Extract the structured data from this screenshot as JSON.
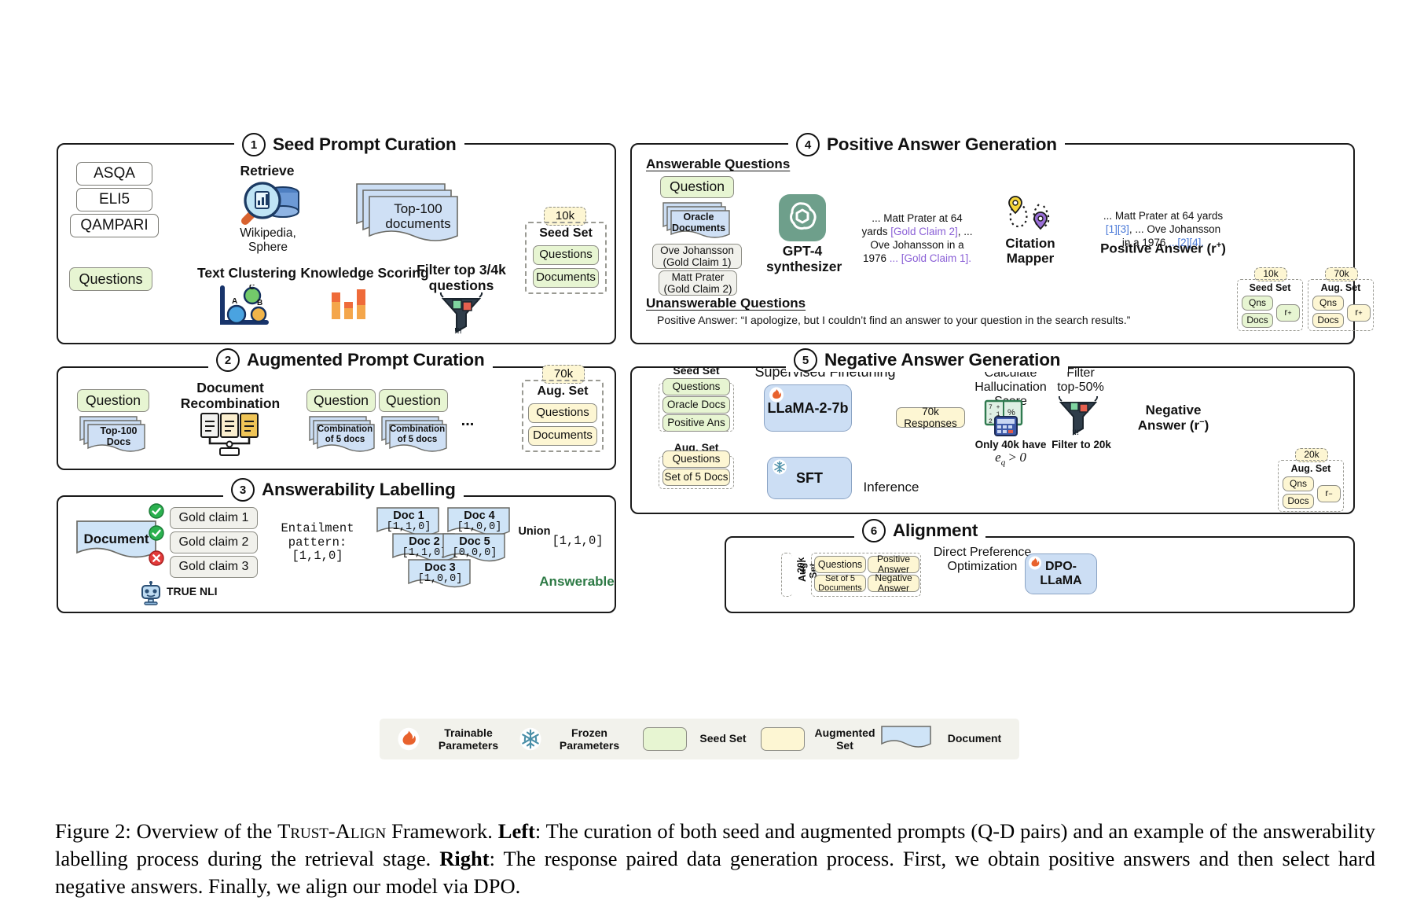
{
  "figure": {
    "caption_label": "Figure 2:",
    "caption_t1": " Overview of the ",
    "caption_sc": "Trust-Align",
    "caption_t2": " Framework. ",
    "caption_left": "Left",
    "caption_t3": ": The curation of both seed and augmented prompts (Q-D pairs) and an example of the answerability labelling process during the retrieval stage. ",
    "caption_right": "Right",
    "caption_t4": ": The response paired data generation process. First, we obtain positive answers and then select hard negative answers. Finally, we align our model via DPO."
  },
  "panel1": {
    "num": "1",
    "title": "Seed Prompt Curation",
    "datasets": [
      "ASQA",
      "ELI5",
      "QAMPARI"
    ],
    "questions": "Questions",
    "retrieve_label": "Retrieve",
    "retrieve_source": "Wikipedia,\nSphere",
    "top100": "Top-100\ndocuments",
    "text_clustering": "Text Clustering",
    "knowledge_scoring": "Knowledge Scoring",
    "filter": "Filter top 3/4k\nquestions",
    "cluster_points": [
      "A",
      "B",
      "C"
    ],
    "seed_badge": "10k",
    "seed_title": "Seed Set",
    "seed_items": [
      "Questions",
      "Documents"
    ]
  },
  "panel2": {
    "num": "2",
    "title": "Augmented Prompt Curation",
    "question": "Question",
    "top100docs": "Top-100\nDocs",
    "recombination": "Document\nRecombination",
    "q_a": "Question",
    "q_b": "Question",
    "combo": "Combination\nof 5 docs",
    "ellipsis": "...",
    "aug_badge": "70k",
    "aug_title": "Aug. Set",
    "aug_items": [
      "Questions",
      "Documents"
    ]
  },
  "panel3": {
    "num": "3",
    "title": "Answerability Labelling",
    "document": "Document",
    "claims": [
      "Gold claim 1",
      "Gold claim 2",
      "Gold claim 3"
    ],
    "nli_label": "TRUE NLI",
    "entailment": "Entailment\npattern:\n[1,1,0]",
    "docs": [
      {
        "name": "Doc 1",
        "pattern": "[1,1,0]"
      },
      {
        "name": "Doc 2",
        "pattern": "[1,1,0]"
      },
      {
        "name": "Doc 3",
        "pattern": "[1,0,0]"
      },
      {
        "name": "Doc 4",
        "pattern": "[1,0,0]"
      },
      {
        "name": "Doc 5",
        "pattern": "[0,0,0]"
      }
    ],
    "union_label": "Union",
    "union_result": "[1,1,0]",
    "answerable": "Answerable"
  },
  "panel4": {
    "num": "4",
    "title": "Positive Answer Generation",
    "answerable_heading": "Answerable Questions",
    "question": "Question",
    "oracle_docs": "Oracle\nDocuments",
    "claim1": "Ove Johansson\n(Gold Claim 1)",
    "claim2": "Matt Prater\n(Gold Claim 2)",
    "gpt4": "GPT-4\nsynthesizer",
    "synth_text_1": "... Matt Prater at 64 yards ",
    "synth_gold2": "[Gold Claim 2]",
    "synth_text_2": ", ... Ove Johansson in a 1976 ",
    "synth_gold1": "... [Gold Claim 1].",
    "citation_mapper": "Citation\nMapper",
    "answer_1": "... Matt Prater at 64 yards ",
    "answer_c1": "[1][3]",
    "answer_2": ", ... Ove Johansson in a 1976 ",
    "answer_c2": "...[2][4].",
    "positive_answer_label": "Positive Answer (r",
    "positive_answer_sup": "+",
    "positive_answer_end": ")",
    "unanswerable_heading": "Unanswerable Questions",
    "unanswerable_text": "Positive Answer: “I apologize, but I couldn’t find an answer to your question in the search results.”",
    "seed_badge": "10k",
    "seed_title": "Seed Set",
    "seed_items": [
      "Qns",
      "Docs"
    ],
    "seed_r": "r",
    "seed_r_sup": "+",
    "aug_badge": "70k",
    "aug_title": "Aug. Set",
    "aug_items": [
      "Qns",
      "Docs"
    ],
    "aug_r": "r",
    "aug_r_sup": "+"
  },
  "panel5": {
    "num": "5",
    "title": "Negative Answer Generation",
    "seed_title": "Seed Set",
    "seed_items": [
      "Questions",
      "Oracle Docs",
      "Positive Ans"
    ],
    "aug_title": "Aug. Set",
    "aug_items": [
      "Questions",
      "Set of 5 Docs"
    ],
    "sft_heading": "Supervised Finetuning",
    "llama": "LLaMA-2-7b",
    "sft": "SFT",
    "inference": "Inference",
    "responses": "70k Responses",
    "hallucination": "Calculate\nHallucination\nScore",
    "hall_sub": "Only 40k have",
    "hall_eq": "e_q > 0",
    "filter_title": "Filter\ntop-50%",
    "filter_sub": "Filter to 20k",
    "negative_answer": "Negative\nAnswer (r",
    "negative_answer_sup": "−",
    "negative_answer_end": ")",
    "out_badge": "20k",
    "out_title": "Aug. Set",
    "out_items": [
      "Qns",
      "Docs"
    ],
    "out_r": "r",
    "out_r_sup": "−"
  },
  "panel6": {
    "num": "6",
    "title": "Alignment",
    "badge": "20k",
    "set_label": "Aug. Set",
    "items": [
      "Questions",
      "Set of  5 Documents",
      "Positive Answer",
      "Negative Answer"
    ],
    "dpo_label": "Direct Preference\nOptimization",
    "model": "DPO-\nLLaMA"
  },
  "legend": {
    "items": [
      {
        "icon": "flame-icon",
        "label": "Trainable\nParameters"
      },
      {
        "icon": "snowflake-icon",
        "label": "Frozen\nParameters"
      },
      {
        "icon": "green-swatch",
        "label": "Seed Set"
      },
      {
        "icon": "cream-swatch",
        "label": "Augmented\nSet"
      },
      {
        "icon": "document-swatch",
        "label": "Document"
      }
    ]
  },
  "colors": {
    "seed_green": "#e7f5d2",
    "aug_cream": "#fdf6d3",
    "doc_blue": "#ccdef4",
    "model_blue": "#ccdef4",
    "gpt_green": "#6e9f8b",
    "purple": "#8a5fd6",
    "citation_blue": "#4a79d8",
    "answerable_green": "#2d7a45"
  }
}
